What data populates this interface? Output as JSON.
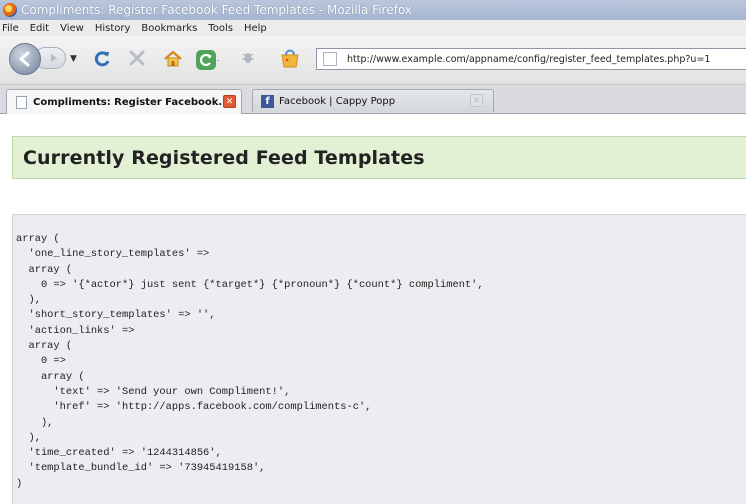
{
  "window": {
    "title": "Compliments: Register Facebook Feed Templates - Mozilla Firefox"
  },
  "menu": {
    "items": [
      "File",
      "Edit",
      "View",
      "History",
      "Bookmarks",
      "Tools",
      "Help"
    ]
  },
  "toolbar": {
    "url": "http://www.example.com/appname/config/register_feed_templates.php?u=1",
    "icons": [
      "back-icon",
      "forward-icon",
      "reload-icon",
      "stop-icon",
      "home-icon",
      "refresh-icon",
      "bug-icon",
      "bag-icon"
    ]
  },
  "tabs": [
    {
      "label": "Compliments: Register Facebook...",
      "active": true
    },
    {
      "label": "Facebook | Cappy Popp",
      "active": false
    }
  ],
  "page": {
    "heading": "Currently Registered Feed Templates",
    "code": "array (\n  'one_line_story_templates' =>\n  array (\n    0 => '{*actor*} just sent {*target*} {*pronoun*} {*count*} compliment',\n  ),\n  'short_story_templates' => '',\n  'action_links' =>\n  array (\n    0 =>\n    array (\n      'text' => 'Send your own Compliment!',\n      'href' => 'http://apps.facebook.com/compliments-c',\n    ),\n  ),\n  'time_created' => '1244314856',\n  'template_bundle_id' => '73945419158',\n)"
  },
  "colors": {
    "titlebar": "#b0bed6",
    "heading_bg": "#e2f0d4",
    "code_bg": "#ececf1",
    "facebook_blue": "#3b5998"
  }
}
